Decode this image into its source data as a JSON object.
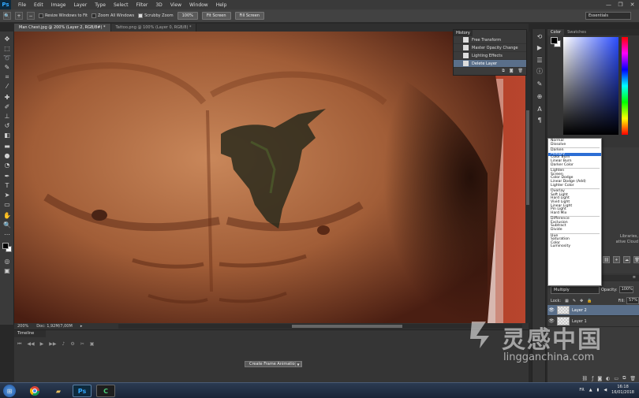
{
  "app": {
    "logo": "Ps",
    "menu": [
      "File",
      "Edit",
      "Image",
      "Layer",
      "Type",
      "Select",
      "Filter",
      "3D",
      "View",
      "Window",
      "Help"
    ],
    "window_controls": [
      "—",
      "❐",
      "✕"
    ]
  },
  "options_bar": {
    "resize_windows": "Resize Windows to Fit",
    "zoom_all_windows": "Zoom All Windows",
    "scrubby_zoom": "Scrubby Zoom",
    "btn_100": "100%",
    "btn_fit_screen": "Fit Screen",
    "btn_fill_screen": "Fill Screen",
    "workspace": "Essentials"
  },
  "tabs": [
    {
      "label": "Man Chest.jpg @ 200% (Layer 2, RGB/8#) *",
      "active": true
    },
    {
      "label": "Tattoo.png @ 100% (Layer 0, RGB/8) *",
      "active": false
    }
  ],
  "status_bar": {
    "zoom": "200%",
    "doc": "Doc: 1,92M/7,00M"
  },
  "timeline": {
    "title": "Timeline",
    "create_button": "Create Frame Animation"
  },
  "history": {
    "title": "History",
    "items": [
      {
        "label": "Free Transform",
        "selected": false
      },
      {
        "label": "Master Opacity Change",
        "selected": false
      },
      {
        "label": "Lighting Effects",
        "selected": false
      },
      {
        "label": "Delete Layer",
        "selected": true
      }
    ]
  },
  "color_panel": {
    "tabs": [
      "Color",
      "Swatches"
    ]
  },
  "libraries_text": {
    "line1": "Libraries,",
    "line2": "ative Cloud"
  },
  "blend_modes": {
    "groups": [
      [
        "Normal",
        "Dissolve"
      ],
      [
        "Darken",
        "Multiply",
        "Color Burn",
        "Linear Burn",
        "Darker Color"
      ],
      [
        "Lighten",
        "Screen",
        "Color Dodge",
        "Linear Dodge (Add)",
        "Lighter Color"
      ],
      [
        "Overlay",
        "Soft Light",
        "Hard Light",
        "Vivid Light",
        "Linear Light",
        "Pin Light",
        "Hard Mix"
      ],
      [
        "Difference",
        "Exclusion",
        "Subtract",
        "Divide"
      ],
      [
        "Hue",
        "Saturation",
        "Color",
        "Luminosity"
      ]
    ],
    "selected": "Multiply"
  },
  "layers_panel": {
    "blend_value": "Multiply",
    "opacity_label": "Opacity:",
    "opacity_value": "100%",
    "lock_label": "Lock:",
    "fill_label": "Fill:",
    "fill_value": "57%",
    "layers": [
      {
        "name": "Layer 2",
        "selected": true
      },
      {
        "name": "Layer 1",
        "selected": false
      }
    ]
  },
  "watermark": {
    "cn": "灵感中国",
    "en": "lingganchina.com"
  },
  "taskbar": {
    "language": "FR",
    "time": "16:18",
    "date": "16/01/2018"
  },
  "colors": {
    "selection_blue": "#2c6ed5",
    "panel_selected": "#5a6f8a",
    "ps_blue": "#31a8ff"
  }
}
